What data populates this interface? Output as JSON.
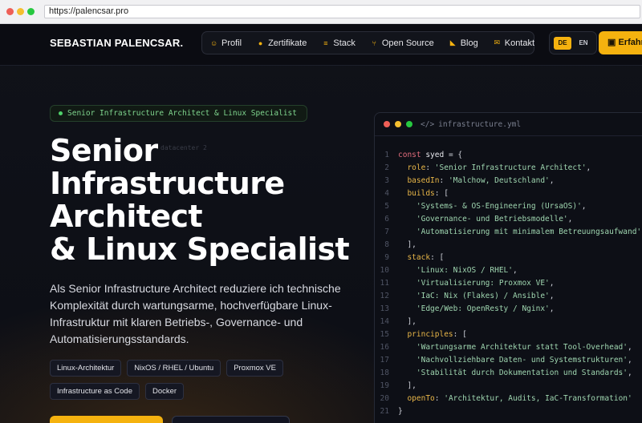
{
  "browser": {
    "url": "https://palencsar.pro",
    "dots": [
      "#ee5f57",
      "#f5bf2f",
      "#27c840"
    ]
  },
  "nav": {
    "brand": "SEBASTIAN PALENCSAR.",
    "items": [
      {
        "label": "Profil",
        "icon": "user-icon"
      },
      {
        "label": "Zertifikate",
        "icon": "certificate-icon"
      },
      {
        "label": "Stack",
        "icon": "layers-icon"
      },
      {
        "label": "Open Source",
        "icon": "git-branch-icon"
      },
      {
        "label": "Blog",
        "icon": "rss-icon"
      },
      {
        "label": "Kontakt",
        "icon": "mail-icon"
      }
    ],
    "lang": {
      "de": "DE",
      "en": "EN",
      "active": "DE"
    },
    "cta_label": "Erfahr"
  },
  "hero": {
    "badge": "Senior Infrastructure Architect & Linux Specialist",
    "ghost": "datacenter 2",
    "title_lines": [
      "Senior",
      "Infrastructure",
      "Architect",
      "& Linux Specialist"
    ],
    "description": "Als Senior Infrastructure Architect reduziere ich technische Komplexität durch wartungsarme, hochverfügbare Linux-Infrastruktur mit klaren Betriebs-, Governance- und Automatisierungsstandards.",
    "tags": [
      "Linux-Architektur",
      "NixOS / RHEL / Ubuntu",
      "Proxmox VE",
      "Infrastructure as Code",
      "Docker"
    ]
  },
  "code": {
    "filename": "infrastructure.yml",
    "lines": [
      [
        [
          "kw",
          "const "
        ],
        [
          "id",
          "syed"
        ],
        [
          "pn",
          " = {"
        ]
      ],
      [
        [
          "pn",
          "  "
        ],
        [
          "key",
          "role"
        ],
        [
          "pn",
          ": "
        ],
        [
          "str",
          "'Senior Infrastructure Architect'"
        ],
        [
          "pn",
          ","
        ]
      ],
      [
        [
          "pn",
          "  "
        ],
        [
          "key",
          "basedIn"
        ],
        [
          "pn",
          ": "
        ],
        [
          "str",
          "'Malchow, Deutschland'"
        ],
        [
          "pn",
          ","
        ]
      ],
      [
        [
          "pn",
          "  "
        ],
        [
          "key",
          "builds"
        ],
        [
          "pn",
          ": ["
        ]
      ],
      [
        [
          "pn",
          "    "
        ],
        [
          "str",
          "'Systems- & OS-Engineering (UrsaOS)'"
        ],
        [
          "pn",
          ","
        ]
      ],
      [
        [
          "pn",
          "    "
        ],
        [
          "str",
          "'Governance- und Betriebsmodelle'"
        ],
        [
          "pn",
          ","
        ]
      ],
      [
        [
          "pn",
          "    "
        ],
        [
          "str",
          "'Automatisierung mit minimalem Betreuungsaufwand'"
        ],
        [
          "pn",
          ","
        ]
      ],
      [
        [
          "pn",
          "  ],"
        ]
      ],
      [
        [
          "pn",
          "  "
        ],
        [
          "key",
          "stack"
        ],
        [
          "pn",
          ": ["
        ]
      ],
      [
        [
          "pn",
          "    "
        ],
        [
          "str",
          "'Linux: NixOS / RHEL'"
        ],
        [
          "pn",
          ","
        ]
      ],
      [
        [
          "pn",
          "    "
        ],
        [
          "str",
          "'Virtualisierung: Proxmox VE'"
        ],
        [
          "pn",
          ","
        ]
      ],
      [
        [
          "pn",
          "    "
        ],
        [
          "str",
          "'IaC: Nix (Flakes) / Ansible'"
        ],
        [
          "pn",
          ","
        ]
      ],
      [
        [
          "pn",
          "    "
        ],
        [
          "str",
          "'Edge/Web: OpenResty / Nginx'"
        ],
        [
          "pn",
          ","
        ]
      ],
      [
        [
          "pn",
          "  ],"
        ]
      ],
      [
        [
          "pn",
          "  "
        ],
        [
          "key",
          "principles"
        ],
        [
          "pn",
          ": ["
        ]
      ],
      [
        [
          "pn",
          "    "
        ],
        [
          "str",
          "'Wartungsarme Architektur statt Tool-Overhead'"
        ],
        [
          "pn",
          ","
        ]
      ],
      [
        [
          "pn",
          "    "
        ],
        [
          "str",
          "'Nachvollziehbare Daten- und Systemstrukturen'"
        ],
        [
          "pn",
          ","
        ]
      ],
      [
        [
          "pn",
          "    "
        ],
        [
          "str",
          "'Stabilität durch Dokumentation und Standards'"
        ],
        [
          "pn",
          ","
        ]
      ],
      [
        [
          "pn",
          "  ],"
        ]
      ],
      [
        [
          "pn",
          "  "
        ],
        [
          "key",
          "openTo"
        ],
        [
          "pn",
          ": "
        ],
        [
          "str",
          "'Architektur, Audits, IaC-Transformation'"
        ]
      ],
      [
        [
          "pn",
          "}"
        ]
      ]
    ]
  }
}
